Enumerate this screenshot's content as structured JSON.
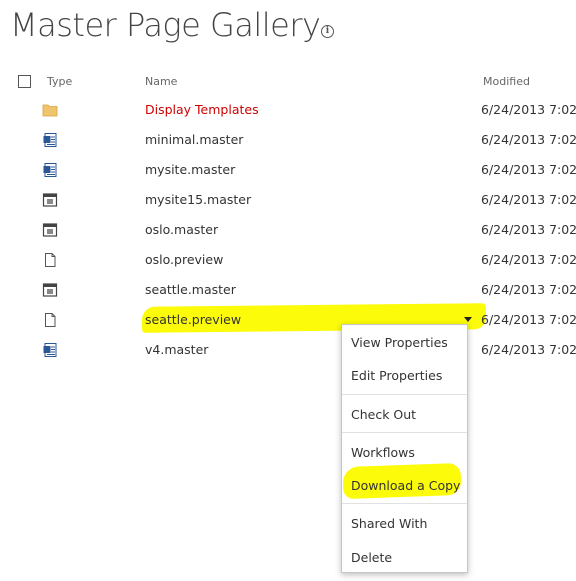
{
  "page": {
    "title": "Master Page Gallery"
  },
  "columns": {
    "type": "Type",
    "name": "Name",
    "modified": "Modified"
  },
  "rows": [
    {
      "name": "Display Templates",
      "modified": "6/24/2013 7:02",
      "icon": "folder-icon"
    },
    {
      "name": "minimal.master",
      "modified": "6/24/2013 7:02",
      "icon": "master-page-icon"
    },
    {
      "name": "mysite.master",
      "modified": "6/24/2013 7:02",
      "icon": "master-page-icon"
    },
    {
      "name": "mysite15.master",
      "modified": "6/24/2013 7:02",
      "icon": "layout-icon"
    },
    {
      "name": "oslo.master",
      "modified": "6/24/2013 7:02",
      "icon": "layout-icon"
    },
    {
      "name": "oslo.preview",
      "modified": "6/24/2013 7:02",
      "icon": "document-icon"
    },
    {
      "name": "seattle.master",
      "modified": "6/24/2013 7:02",
      "icon": "layout-icon"
    },
    {
      "name": "seattle.preview",
      "modified": "6/24/2013 7:02",
      "icon": "document-icon"
    },
    {
      "name": "v4.master",
      "modified": "6/24/2013 7:02",
      "icon": "master-page-icon"
    }
  ],
  "context_menu": {
    "items": [
      "View Properties",
      "Edit Properties",
      "Check Out",
      "Workflows",
      "Download a Copy",
      "Shared With",
      "Delete"
    ]
  },
  "colors": {
    "folder_link": "#c00000",
    "highlight": "#fbfb0a",
    "folder": "#f0c36d"
  }
}
